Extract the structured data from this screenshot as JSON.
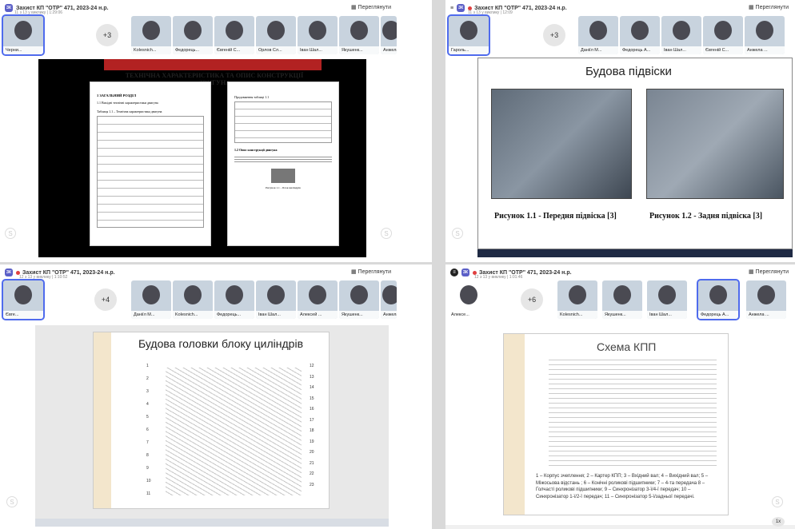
{
  "header_title": "Захист КП \"ОТР\" 471, 2023-24 н.р.",
  "view_label": "Переглянути",
  "rate_label": "1x",
  "q1": {
    "sub": "11 з 13 у виклику | 1:29:06",
    "more": "+3",
    "self": "Черни...",
    "tiles": [
      "Kolesnich...",
      "Федорець...",
      "Євгеній С...",
      "Орлов Сл...",
      "Іван Шал...",
      "Якушенк...",
      "Анжела ..."
    ],
    "slide_title": "ТЕХНІЧНА ХАРАКТЕРИСТИКА ТА ОПИС КОНСТРУКЦІЇ ДВИГУНА",
    "left_heading": "1 ЗАГАЛЬНИЙ РОЗДІЛ",
    "left_sub": "1.1 Вихідні технічні характеристики двигуна",
    "table_caption": "Таблиця 1.1 – Технічна характеристика двигуна",
    "right_caption": "Продовження таблиці 1.1",
    "right_heading": "1.2 Опис конструкції двигуна",
    "right_fig": "Рисунок 1.1 – Блок циліндрів"
  },
  "q2": {
    "sub": "11 з 13 у виклику | 12:09",
    "more": "+3",
    "self": "Гароль...",
    "tiles": [
      "Даніїл М...",
      "Федорець А...",
      "Іван Шал...",
      "Євгеній С...",
      "Анжела ..."
    ],
    "slide_title": "Будова підвіски",
    "cap1": "Рисунок 1.1 - Передня підвіска [3]",
    "cap2": "Рисунок 1.2 - Задня підвіска [3]"
  },
  "q3": {
    "sub": "12 з 13 у виклику | 1:10:52",
    "more": "+4",
    "self": "Євге...",
    "tiles": [
      "Даніїл М...",
      "Kolesnich...",
      "Федорець...",
      "Іван Шал...",
      "Алексей ...",
      "Якушенк...",
      "Анжела ..."
    ],
    "slide_title": "Будова головки блоку циліндрів",
    "nums_left": [
      "1",
      "2",
      "3",
      "4",
      "5",
      "6",
      "7",
      "8",
      "9",
      "10",
      "11"
    ],
    "nums_right": [
      "12",
      "13",
      "14",
      "15",
      "16",
      "17",
      "18",
      "19",
      "20",
      "21",
      "22",
      "23"
    ]
  },
  "q4": {
    "sub": "12 з 13 у виклику | 1:01:46",
    "more": "+6",
    "self": "Алексе...",
    "tiles": [
      "Kolesnich...",
      "Якушенк...",
      "Іван Шал...",
      "Федорець А...",
      "Анжела ..."
    ],
    "slide_title": "Схема КПП",
    "legend": "1 – Корпус зчеплення; 2 – Картер КПП; 3 – Вхідний вал; 4 – Вихідний вал; 5 – Міжосьова відстань ; 6 – Конічні роликові підшипники; 7 – 4-та передача 8 – Голчасті роликові підшипники; 9 – Синхронізатор 3-ї/4-ї передач; 10 – Синхронізатор 1-ї/2-ї передач; 11 – Синхронізатор 5-ї/задньої передачі."
  }
}
